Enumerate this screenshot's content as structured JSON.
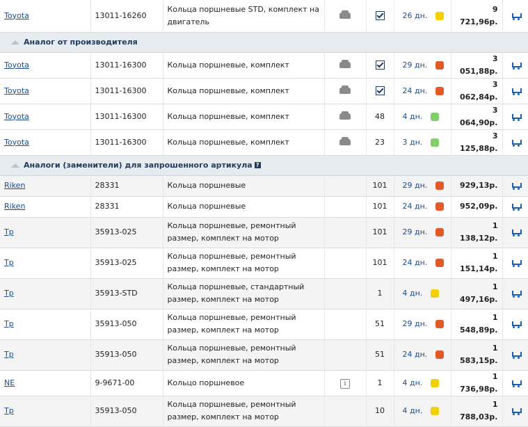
{
  "colors": {
    "yellow": "#f2d000",
    "red": "#e25a2a",
    "green": "#7fcf6a",
    "link": "#1a4a8c",
    "section_bg": "#e6ebf0"
  },
  "rows_top": [
    {
      "brand": "Toyota",
      "article": "13011-16260",
      "desc": "Кольца поршневые STD, комплект на двигатель",
      "icon": "car-icon",
      "qty": "",
      "checked": true,
      "days": "26 дн.",
      "status": "yellow",
      "price": "9 721,96р."
    }
  ],
  "section1": {
    "title": "Аналог от производителя"
  },
  "rows_s1": [
    {
      "brand": "Toyota",
      "article": "13011-16300",
      "desc": "Кольца поршневые, комплект",
      "icon": "car-icon",
      "qty": "",
      "checked": true,
      "days": "29 дн.",
      "status": "red",
      "price": "3 051,88р."
    },
    {
      "brand": "Toyota",
      "article": "13011-16300",
      "desc": "Кольца поршневые, комплект",
      "icon": "car-icon",
      "qty": "",
      "checked": true,
      "days": "24 дн.",
      "status": "red",
      "price": "3 062,84р."
    },
    {
      "brand": "Toyota",
      "article": "13011-16300",
      "desc": "Кольца поршневые, комплект",
      "icon": "car-icon",
      "qty": "48",
      "checked": false,
      "days": "4 дн.",
      "status": "green",
      "price": "3 064,90р."
    },
    {
      "brand": "Toyota",
      "article": "13011-16300",
      "desc": "Кольца поршневые, комплект",
      "icon": "car-icon",
      "qty": "23",
      "checked": false,
      "days": "3 дн.",
      "status": "green",
      "price": "3 125,88р."
    }
  ],
  "section2": {
    "title": "Аналоги (заменители) для запрошенного артикула",
    "help": "?"
  },
  "rows_s2": [
    {
      "brand": "Riken",
      "article": "28331",
      "desc": "Кольца поршневые",
      "icon": "",
      "qty": "101",
      "days": "29 дн.",
      "status": "red",
      "price": "929,13р."
    },
    {
      "brand": "Riken",
      "article": "28331",
      "desc": "Кольца поршневые",
      "icon": "",
      "qty": "101",
      "days": "24 дн.",
      "status": "red",
      "price": "952,09р."
    },
    {
      "brand": "Tp",
      "article": "35913-025",
      "desc": "Кольца поршневые, ремонтный размер, комплект на мотор",
      "icon": "",
      "qty": "101",
      "days": "29 дн.",
      "status": "red",
      "price": "1 138,12р."
    },
    {
      "brand": "Tp",
      "article": "35913-025",
      "desc": "Кольца поршневые, ремонтный размер, комплект на мотор",
      "icon": "",
      "qty": "101",
      "days": "24 дн.",
      "status": "red",
      "price": "1 151,14р."
    },
    {
      "brand": "Tp",
      "article": "35913-STD",
      "desc": "Кольца поршневые, стандартный размер, комплект на мотор",
      "icon": "",
      "qty": "1",
      "days": "4 дн.",
      "status": "yellow",
      "price": "1 497,16р."
    },
    {
      "brand": "Tp",
      "article": "35913-050",
      "desc": "Кольца поршневые, ремонтный размер, комплект на мотор",
      "icon": "",
      "qty": "51",
      "days": "29 дн.",
      "status": "red",
      "price": "1 548,89р."
    },
    {
      "brand": "Tp",
      "article": "35913-050",
      "desc": "Кольца поршневые, ремонтный размер, комплект на мотор",
      "icon": "",
      "qty": "51",
      "days": "24 дн.",
      "status": "red",
      "price": "1 583,15р."
    },
    {
      "brand": "NE",
      "article": "9-9671-00",
      "desc": "Кольцо поршневое",
      "icon": "info-icon",
      "qty": "1",
      "days": "4 дн.",
      "status": "yellow",
      "price": "1 736,98р."
    },
    {
      "brand": "Tp",
      "article": "35913-050",
      "desc": "Кольца поршневые, ремонтный размер, комплект на мотор",
      "icon": "",
      "qty": "10",
      "days": "4 дн.",
      "status": "yellow",
      "price": "1 788,03р."
    }
  ]
}
